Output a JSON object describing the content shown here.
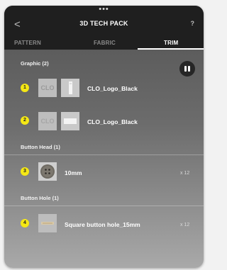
{
  "header": {
    "grip": "•••",
    "back": "<",
    "title": "3D TECH PACK",
    "help": "?"
  },
  "tabs": [
    {
      "label": "PATTERN",
      "active": false
    },
    {
      "label": "FABRIC",
      "active": false
    },
    {
      "label": "TRIM",
      "active": true
    }
  ],
  "sections": {
    "graphic": {
      "label": "Graphic (2)"
    },
    "button_head": {
      "label": "Button Head (1)"
    },
    "button_hole": {
      "label": "Button Hole (1)"
    }
  },
  "items": [
    {
      "number": "1",
      "name": "CLO_Logo_Black",
      "quantity": ""
    },
    {
      "number": "2",
      "name": "CLO_Logo_Black",
      "quantity": ""
    },
    {
      "number": "3",
      "name": "10mm",
      "quantity": "x 12"
    },
    {
      "number": "4",
      "name": "Square button hole_15mm",
      "quantity": "x 12"
    }
  ],
  "thumb_text": {
    "logo": "CLO"
  },
  "colors": {
    "header_bg": "#1f1f1f",
    "badge": "#f5e814",
    "active_tab": "#ffffff",
    "inactive_tab": "#8a8a8a"
  },
  "icons": {
    "back": "chevron-left-icon",
    "toggle": "pause-view-icon"
  }
}
